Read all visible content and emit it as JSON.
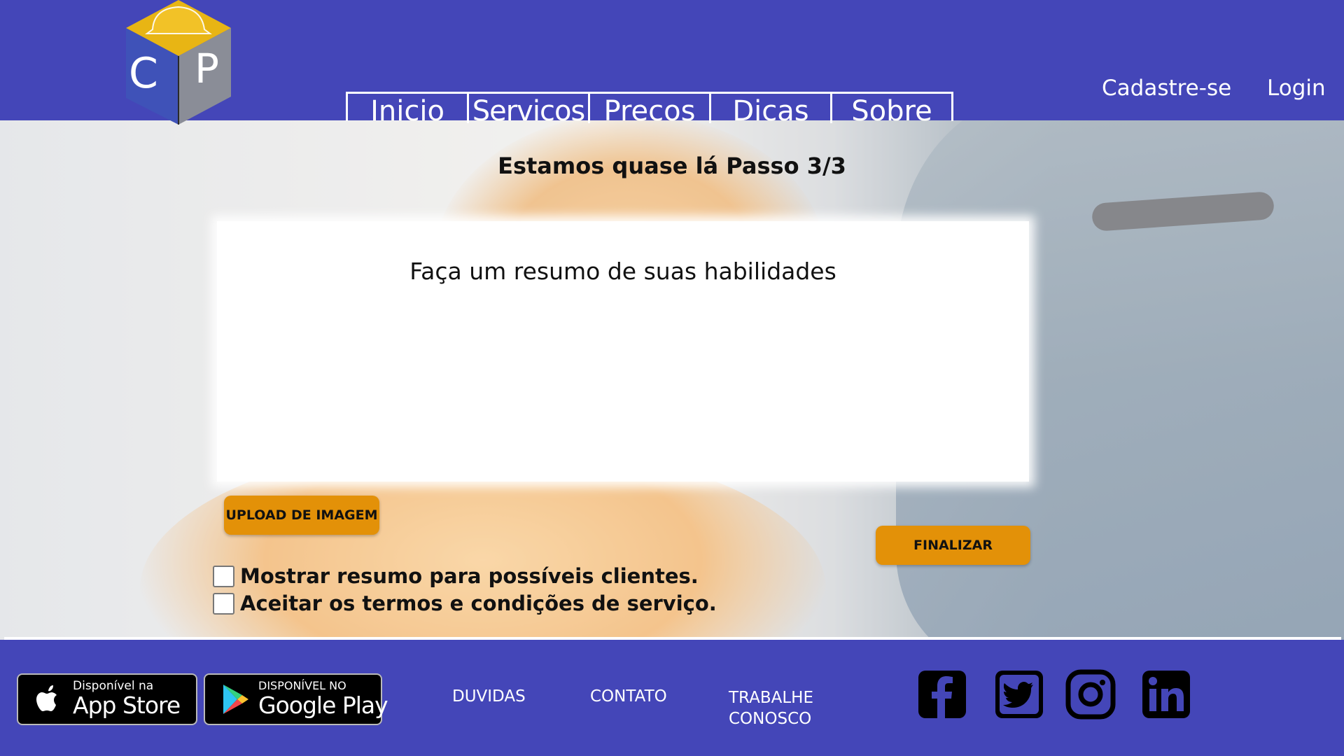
{
  "colors": {
    "brand_blue": "#4446b8",
    "accent_orange": "#e39108",
    "text_dark": "#111111",
    "white": "#ffffff"
  },
  "header": {
    "logo": {
      "letters": [
        "C",
        "P"
      ],
      "icon": "cube-helmet-logo"
    },
    "nav": [
      {
        "label": "Inicio"
      },
      {
        "label": "Servicos"
      },
      {
        "label": "Precos"
      },
      {
        "label": "Dicas"
      },
      {
        "label": "Sobre"
      }
    ],
    "signup_label": "Cadastre-se",
    "login_label": "Login"
  },
  "main": {
    "step_title": "Estamos quase lá Passo 3/3",
    "summary": {
      "placeholder": "Faça um resumo de suas habilidades",
      "value": ""
    },
    "upload_label": "UPLOAD DE IMAGEM",
    "finish_label": "FINALIZAR",
    "checkboxes": [
      {
        "label": "Mostrar resumo para possíveis clientes.",
        "checked": false
      },
      {
        "label": "Aceitar os termos e condições de serviço.",
        "checked": false
      }
    ]
  },
  "footer": {
    "app_store": {
      "small": "Disponível na",
      "big": "App Store",
      "icon": "apple-icon"
    },
    "google_play": {
      "small": "DISPONÍVEL NO",
      "big": "Google Play",
      "icon": "google-play-icon"
    },
    "links": [
      "DUVIDAS",
      "CONTATO",
      "TRABALHE CONOSCO"
    ],
    "social": [
      "facebook-icon",
      "twitter-icon",
      "instagram-icon",
      "linkedin-icon"
    ]
  }
}
